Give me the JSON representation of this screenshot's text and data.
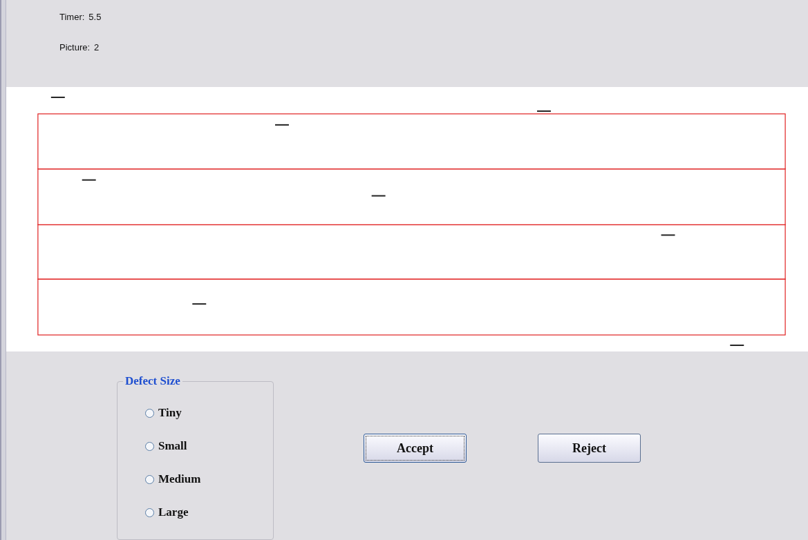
{
  "status": {
    "timer_label": "Timer:",
    "timer_value": "5.5",
    "picture_label": "Picture:",
    "picture_value": "2"
  },
  "defect_size": {
    "title": "Defect Size",
    "options": [
      {
        "label": "Tiny",
        "selected": false
      },
      {
        "label": "Small",
        "selected": false
      },
      {
        "label": "Medium",
        "selected": false
      },
      {
        "label": "Large",
        "selected": false
      }
    ]
  },
  "buttons": [
    {
      "label": "Accept",
      "focused": true
    },
    {
      "label": "Reject",
      "focused": false
    }
  ]
}
